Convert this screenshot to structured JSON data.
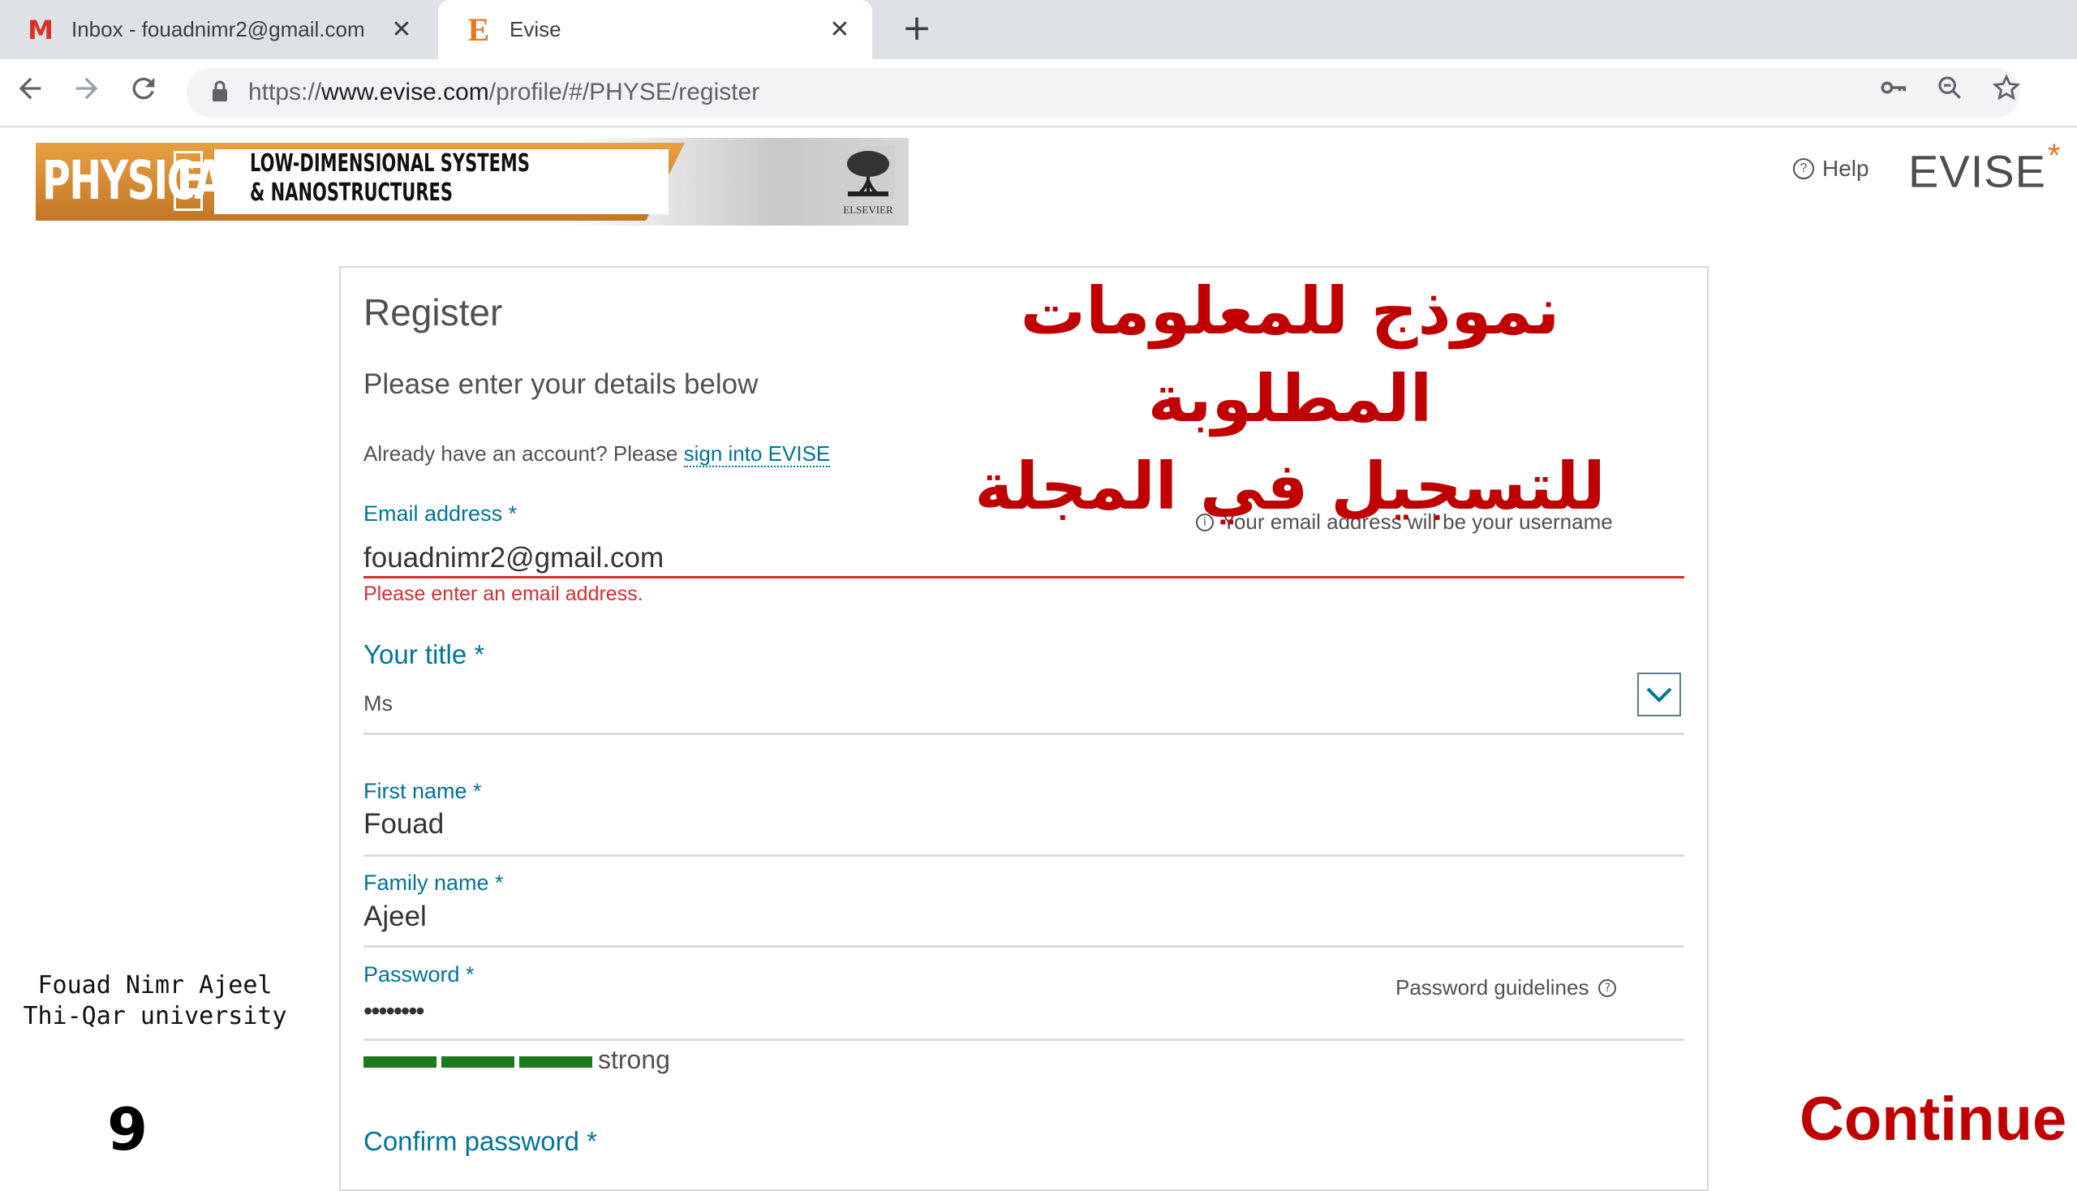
{
  "browser": {
    "tabs": [
      {
        "title": "Inbox - fouadnimr2@gmail.com",
        "favicon": "gmail-icon",
        "active": false
      },
      {
        "title": "Evise",
        "favicon": "evise-icon",
        "active": true
      }
    ],
    "close_glyph": "✕",
    "new_tab_glyph": "+",
    "url_prefix": "https://",
    "url_host": "www.evise.com",
    "url_path": "/profile/#/PHYSE/register"
  },
  "header": {
    "journal_brand": "PHYSICA",
    "journal_letter": "E",
    "journal_subtitle_1": "LOW-DIMENSIONAL SYSTEMS",
    "journal_subtitle_2": "& NANOSTRUCTURES",
    "publisher": "ELSEVIER",
    "help_label": "Help",
    "logo_text": "EVISE",
    "logo_accent": "*",
    "accent_color": "#e87722"
  },
  "form": {
    "title": "Register",
    "subtitle": "Please enter your details below",
    "already_text": "Already have an account? Please ",
    "signin_link": "sign into EVISE",
    "email": {
      "label": "Email address *",
      "hint": "Your email address will be your username",
      "value": "fouadnimr2@gmail.com",
      "error": "Please enter an email address."
    },
    "title_field": {
      "label": "Your title *",
      "value": "Ms"
    },
    "first_name": {
      "label": "First name *",
      "value": "Fouad"
    },
    "family_name": {
      "label": "Family name *",
      "value": "Ajeel"
    },
    "password": {
      "label": "Password *",
      "hint": "Password guidelines",
      "value": "••••••••",
      "strength": "strong",
      "strength_bars": 3
    },
    "confirm_password": {
      "label": "Confirm password *"
    },
    "brand_color": "#007398",
    "error_color": "#d32f2f"
  },
  "overlay": {
    "arabic_line_1": "نموذج للمعلومات المطلوبة",
    "arabic_line_2": "للتسجيل في المجلة",
    "author_name": "Fouad Nimr Ajeel",
    "author_affiliation": "Thi-Qar university",
    "page_number": "9",
    "continue_label": "Continue",
    "annotation_color": "#c00000"
  }
}
